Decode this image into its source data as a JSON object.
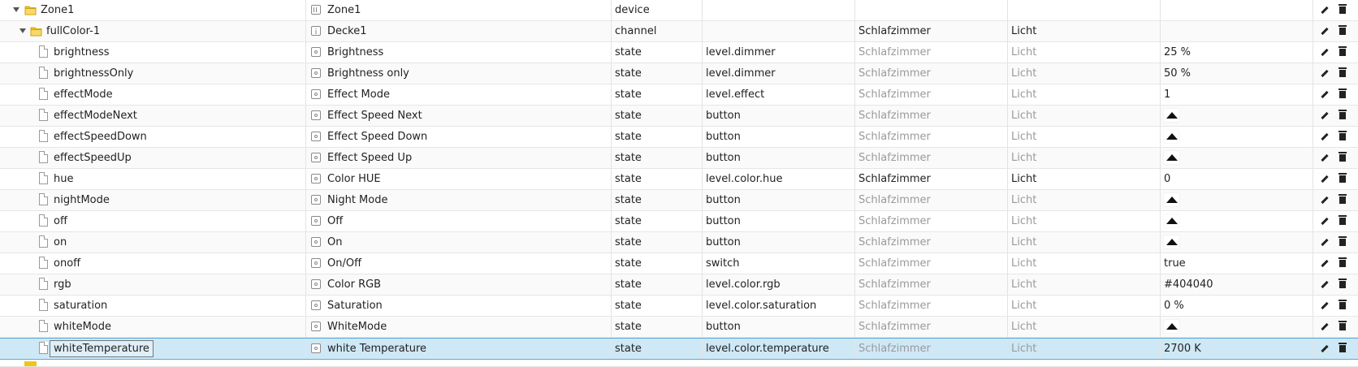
{
  "colors": {
    "selected_row": "#cfe8f6",
    "folder": "#f0c419"
  },
  "rows": [
    {
      "id": "Zone1",
      "name": "Zone1",
      "type": "device",
      "role": "",
      "room": "",
      "function": "",
      "value": "",
      "level": 0,
      "kind": "folder",
      "role_icon": "device-icon",
      "muted": false
    },
    {
      "id": "fullColor-1",
      "name": "Decke1",
      "type": "channel",
      "role": "",
      "room": "Schlafzimmer",
      "function": "Licht",
      "value": "",
      "level": 1,
      "kind": "folder",
      "role_icon": "channel-icon",
      "muted": false
    },
    {
      "id": "brightness",
      "name": "Brightness",
      "type": "state",
      "role": "level.dimmer",
      "room": "Schlafzimmer",
      "function": "Licht",
      "value": "25 %",
      "level": 2,
      "kind": "file",
      "role_icon": "state-icon",
      "muted": true
    },
    {
      "id": "brightnessOnly",
      "name": "Brightness only",
      "type": "state",
      "role": "level.dimmer",
      "room": "Schlafzimmer",
      "function": "Licht",
      "value": "50 %",
      "level": 2,
      "kind": "file",
      "role_icon": "state-icon",
      "muted": true
    },
    {
      "id": "effectMode",
      "name": "Effect Mode",
      "type": "state",
      "role": "level.effect",
      "room": "Schlafzimmer",
      "function": "Licht",
      "value": "1",
      "level": 2,
      "kind": "file",
      "role_icon": "state-icon",
      "muted": true
    },
    {
      "id": "effectModeNext",
      "name": "Effect Speed Next",
      "type": "state",
      "role": "button",
      "room": "Schlafzimmer",
      "function": "Licht",
      "value": "",
      "is_button": true,
      "level": 2,
      "kind": "file",
      "role_icon": "state-icon",
      "muted": true
    },
    {
      "id": "effectSpeedDown",
      "name": "Effect Speed Down",
      "type": "state",
      "role": "button",
      "room": "Schlafzimmer",
      "function": "Licht",
      "value": "",
      "is_button": true,
      "level": 2,
      "kind": "file",
      "role_icon": "state-icon",
      "muted": true
    },
    {
      "id": "effectSpeedUp",
      "name": "Effect Speed Up",
      "type": "state",
      "role": "button",
      "room": "Schlafzimmer",
      "function": "Licht",
      "value": "",
      "is_button": true,
      "level": 2,
      "kind": "file",
      "role_icon": "state-icon",
      "muted": true
    },
    {
      "id": "hue",
      "name": "Color HUE",
      "type": "state",
      "role": "level.color.hue",
      "room": "Schlafzimmer",
      "function": "Licht",
      "value": "0",
      "level": 2,
      "kind": "file",
      "role_icon": "state-icon",
      "muted": false
    },
    {
      "id": "nightMode",
      "name": "Night Mode",
      "type": "state",
      "role": "button",
      "room": "Schlafzimmer",
      "function": "Licht",
      "value": "",
      "is_button": true,
      "level": 2,
      "kind": "file",
      "role_icon": "state-icon",
      "muted": true
    },
    {
      "id": "off",
      "name": "Off",
      "type": "state",
      "role": "button",
      "room": "Schlafzimmer",
      "function": "Licht",
      "value": "",
      "is_button": true,
      "level": 2,
      "kind": "file",
      "role_icon": "state-icon",
      "muted": true
    },
    {
      "id": "on",
      "name": "On",
      "type": "state",
      "role": "button",
      "room": "Schlafzimmer",
      "function": "Licht",
      "value": "",
      "is_button": true,
      "level": 2,
      "kind": "file",
      "role_icon": "state-icon",
      "muted": true
    },
    {
      "id": "onoff",
      "name": "On/Off",
      "type": "state",
      "role": "switch",
      "room": "Schlafzimmer",
      "function": "Licht",
      "value": "true",
      "level": 2,
      "kind": "file",
      "role_icon": "state-icon",
      "muted": true
    },
    {
      "id": "rgb",
      "name": "Color RGB",
      "type": "state",
      "role": "level.color.rgb",
      "room": "Schlafzimmer",
      "function": "Licht",
      "value": "#404040",
      "level": 2,
      "kind": "file",
      "role_icon": "state-icon",
      "muted": true
    },
    {
      "id": "saturation",
      "name": "Saturation",
      "type": "state",
      "role": "level.color.saturation",
      "room": "Schlafzimmer",
      "function": "Licht",
      "value": "0 %",
      "level": 2,
      "kind": "file",
      "role_icon": "state-icon",
      "muted": true
    },
    {
      "id": "whiteMode",
      "name": "WhiteMode",
      "type": "state",
      "role": "button",
      "room": "Schlafzimmer",
      "function": "Licht",
      "value": "",
      "is_button": true,
      "level": 2,
      "kind": "file",
      "role_icon": "state-icon",
      "muted": true
    },
    {
      "id": "whiteTemperature",
      "name": "white Temperature",
      "type": "state",
      "role": "level.color.temperature",
      "room": "Schlafzimmer",
      "function": "Licht",
      "value": "2700 K",
      "level": 2,
      "kind": "file",
      "role_icon": "state-icon",
      "muted": true,
      "selected": true
    }
  ]
}
